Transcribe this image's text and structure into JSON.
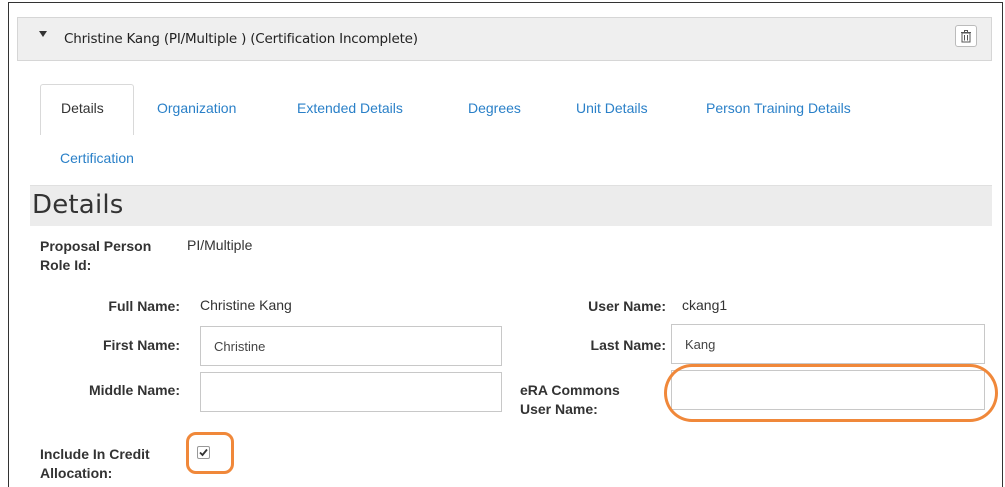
{
  "header": {
    "title": "Christine Kang (PI/Multiple ) (Certification Incomplete)"
  },
  "tabs": [
    {
      "label": "Details"
    },
    {
      "label": "Organization"
    },
    {
      "label": "Extended Details"
    },
    {
      "label": "Degrees"
    },
    {
      "label": "Unit Details"
    },
    {
      "label": "Person Training Details"
    },
    {
      "label": "Certification"
    }
  ],
  "section": {
    "title": "Details"
  },
  "fields": {
    "role_label_1": "Proposal Person",
    "role_label_2": "Role Id:",
    "role_value": "PI/Multiple",
    "full_name_label": "Full Name:",
    "full_name_value": "Christine Kang",
    "user_name_label": "User Name:",
    "user_name_value": "ckang1",
    "first_name_label": "First Name:",
    "first_name_value": "Christine",
    "last_name_label": "Last Name:",
    "last_name_value": "Kang",
    "middle_name_label": "Middle Name:",
    "middle_name_value": "",
    "era_label_1": "eRA Commons",
    "era_label_2": "User Name:",
    "era_value": "",
    "credit_label_1": "Include In Credit",
    "credit_label_2": "Allocation:",
    "credit_checked": true
  },
  "colors": {
    "link": "#2a80c8",
    "highlight": "#f0883a",
    "header_bg": "#efefef"
  }
}
